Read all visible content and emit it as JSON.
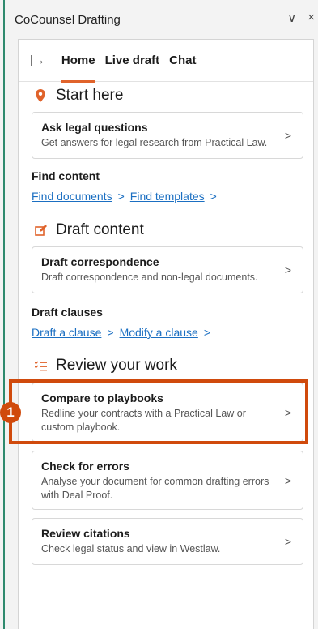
{
  "window": {
    "title": "CoCounsel Drafting",
    "controls": {
      "dropdown": "∨",
      "close": "×"
    }
  },
  "tabs": {
    "collapse_glyph": "|→",
    "items": [
      {
        "label": "Home",
        "active": true
      },
      {
        "label": "Live draft",
        "active": false
      },
      {
        "label": "Chat",
        "active": false
      }
    ]
  },
  "start_here": {
    "heading": "Start here",
    "icon": "location-pin-icon",
    "card": {
      "title": "Ask legal questions",
      "desc": "Get answers for legal research from Practical Law."
    },
    "find_content": {
      "label": "Find content",
      "link1": "Find documents",
      "link2": "Find templates"
    }
  },
  "draft_content": {
    "heading": "Draft content",
    "icon": "edit-icon",
    "card": {
      "title": "Draft correspondence",
      "desc": "Draft correspondence and non-legal documents."
    },
    "draft_clauses": {
      "label": "Draft clauses",
      "link1": "Draft a clause",
      "link2": "Modify a clause"
    }
  },
  "review": {
    "heading": "Review your work",
    "icon": "checklist-icon",
    "cards": [
      {
        "title": "Compare to playbooks",
        "desc": "Redline your contracts with a Practical Law or custom playbook."
      },
      {
        "title": "Check for errors",
        "desc": "Analyse your document for common drafting errors with Deal Proof."
      },
      {
        "title": "Review citations",
        "desc": "Check legal status and view in Westlaw."
      }
    ]
  },
  "annotation": {
    "step": "1"
  },
  "colors": {
    "accent": "#e0632b",
    "link": "#1b6fc2",
    "highlight": "#d04a0c",
    "frame": "#2f8a6e"
  }
}
